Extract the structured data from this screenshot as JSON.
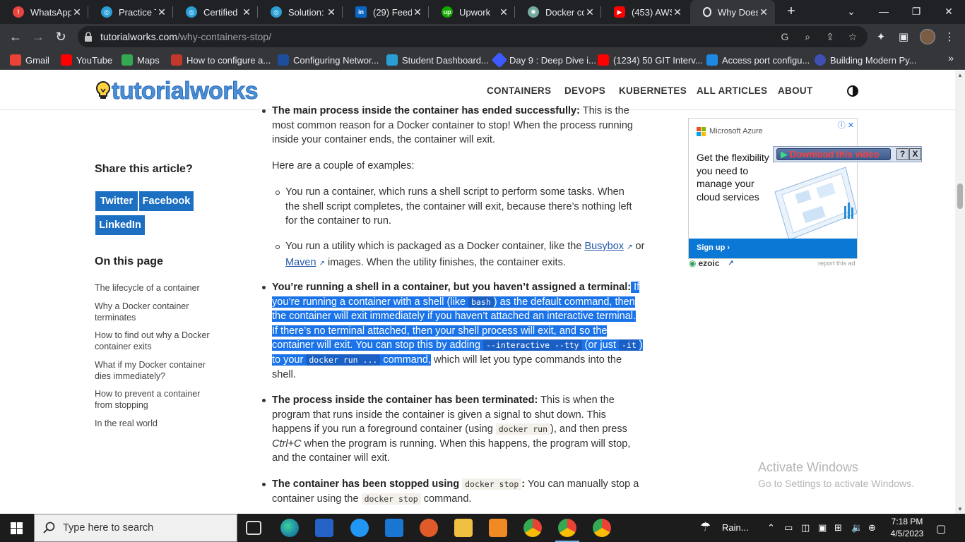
{
  "browser": {
    "tabs": [
      {
        "title": "WhatsApp",
        "icon": "whatsapp-icon",
        "color": "#e8453c"
      },
      {
        "title": "Practice Te",
        "icon": "practice-icon",
        "color": "#2a9fd6"
      },
      {
        "title": "Certified K",
        "icon": "certified-icon",
        "color": "#2a9fd6"
      },
      {
        "title": "Solution: I",
        "icon": "solution-icon",
        "color": "#2a9fd6"
      },
      {
        "title": "(29) Feed |",
        "icon": "linkedin-icon",
        "color": "#0a66c2"
      },
      {
        "title": "Upwork",
        "icon": "upwork-icon",
        "color": "#14a800"
      },
      {
        "title": "Docker co",
        "icon": "chatgpt-icon",
        "color": "#74aa9c"
      },
      {
        "title": "(453) AWS",
        "icon": "youtube-icon",
        "color": "#ff0000"
      },
      {
        "title": "Why Does",
        "icon": "tutorialworks-icon",
        "color": "#ffffff"
      }
    ],
    "url_host": "tutorialworks.com",
    "url_path": "/why-containers-stop/",
    "bookmarks": [
      {
        "label": "Gmail",
        "color": "#ea4335"
      },
      {
        "label": "YouTube",
        "color": "#ff0000"
      },
      {
        "label": "Maps",
        "color": "#34a853"
      },
      {
        "label": "How to configure a...",
        "color": "#c0392b"
      },
      {
        "label": "Configuring Networ...",
        "color": "#1d4e9b"
      },
      {
        "label": "Student Dashboard...",
        "color": "#2a9fd6"
      },
      {
        "label": "Day 9 : Deep Dive i...",
        "color": "#3d5afe"
      },
      {
        "label": "(1234) 50 GIT Interv...",
        "color": "#ff0000"
      },
      {
        "label": "Access port configu...",
        "color": "#1e88e5"
      },
      {
        "label": "Building Modern Py...",
        "color": "#3f51b5"
      }
    ]
  },
  "site": {
    "logo": "tutorialworks",
    "nav": [
      "CONTAINERS",
      "DEVOPS",
      "KUBERNETES",
      "ALL ARTICLES",
      "ABOUT"
    ]
  },
  "sidebar": {
    "share_title": "Share this article?",
    "share_buttons": [
      "Twitter",
      "Facebook",
      "LinkedIn"
    ],
    "toc_title": "On this page",
    "toc": [
      "The lifecycle of a container",
      "Why a Docker container terminates",
      "How to find out why a Docker container exits",
      "What if my Docker container dies immediately?",
      "How to prevent a container from stopping",
      "In the real world"
    ]
  },
  "article": {
    "item1_bold": "The main process inside the container has ended successfully:",
    "item1_text": " This is the most common reason for a Docker container to stop! When the process running inside your container ends, the container will exit.",
    "examples_intro": "Here are a couple of examples:",
    "ex1": "You run a container, which runs a shell script to perform some tasks. When the shell script completes, the container will exit, because there’s nothing left for the container to run.",
    "ex2_a": "You run a utility which is packaged as a Docker container, like the ",
    "ex2_link1": "Busybox",
    "ex2_b": " or ",
    "ex2_link2": "Maven",
    "ex2_c": " images. When the utility finishes, the container exits.",
    "item2_bold": "You’re running a shell in a container, but you haven’t assigned a terminal:",
    "item2_s1": " If you’re running a container with a shell (like ",
    "item2_code1": "bash",
    "item2_s2": ") as the default command, then the container will exit immediately if you haven’t attached an interactive terminal. If there’s no terminal attached, then your shell process will exit, and so the container will exit. You can stop this by adding ",
    "item2_code2": "--interactive --tty",
    "item2_s3": " (or just ",
    "item2_code3": "-it",
    "item2_s4": ") to your ",
    "item2_code4": "docker run ...",
    "item2_s5": " command,",
    "item2_rest": " which will let you type commands into the shell.",
    "item3_bold": "The process inside the container has been terminated:",
    "item3_a": " This is when the program that runs inside the container is given a signal to shut down. This happens if you run a foreground container (using ",
    "item3_code": "docker run",
    "item3_b": "), and then press ",
    "item3_em": "Ctrl+C",
    "item3_c": " when the program is running. When this happens, the program will stop, and the container will exit.",
    "item4_bold": "The container has been stopped using ",
    "item4_code1": "docker stop",
    "item4_colon": ":",
    "item4_a": " You can manually stop a container using the ",
    "item4_code2": "docker stop",
    "item4_b": " command."
  },
  "ad": {
    "brand": "Microsoft Azure",
    "body": "Get the flexibility you need to manage your cloud services",
    "cta": "Sign up ›",
    "ezoic": "ezoic",
    "report": "report this ad",
    "download": "Download this video",
    "download_help": "?",
    "download_close": "X"
  },
  "watermark": {
    "line1": "Activate Windows",
    "line2": "Go to Settings to activate Windows."
  },
  "taskbar": {
    "search_placeholder": "Type here to search",
    "weather": "Rain...",
    "time": "7:18 PM",
    "date": "4/5/2023"
  }
}
